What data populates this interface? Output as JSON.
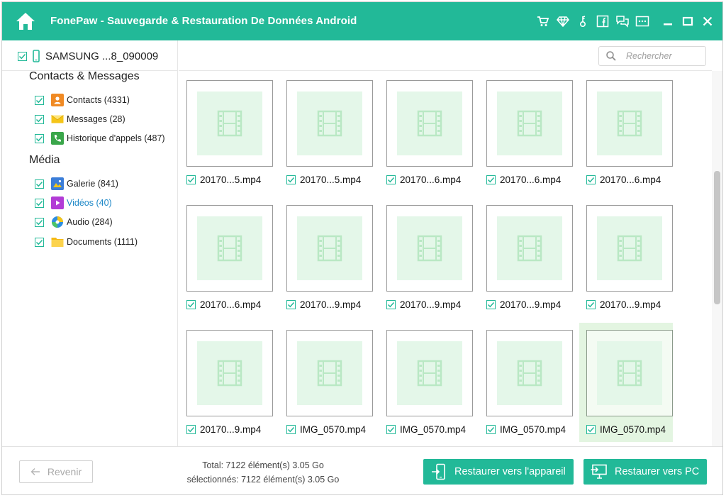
{
  "app": {
    "title": "FonePaw - Sauvegarde & Restauration De Données Android",
    "accent_color": "#22b998"
  },
  "titlebar": {
    "icons": [
      "home-icon",
      "cart-icon",
      "diamond-icon",
      "key-icon",
      "facebook-icon",
      "feedback-icon",
      "menu-icon",
      "minimize-icon",
      "maximize-icon",
      "close-icon"
    ]
  },
  "sidebar": {
    "device_name": "SAMSUNG ...8_090009",
    "sections": [
      {
        "title": "Contacts & Messages",
        "items": [
          {
            "label": "Contacts (4331)",
            "icon": "contacts-icon",
            "checked": true
          },
          {
            "label": "Messages (28)",
            "icon": "messages-icon",
            "checked": true
          },
          {
            "label": "Historique d'appels (487)",
            "icon": "call-history-icon",
            "checked": true
          }
        ]
      },
      {
        "title": "Média",
        "items": [
          {
            "label": "Galerie (841)",
            "icon": "gallery-icon",
            "checked": true
          },
          {
            "label": "Vidéos (40)",
            "icon": "videos-icon",
            "checked": true,
            "active": true
          },
          {
            "label": "Audio (284)",
            "icon": "audio-icon",
            "checked": true
          },
          {
            "label": "Documents (1111)",
            "icon": "documents-icon",
            "checked": true
          }
        ]
      }
    ]
  },
  "search": {
    "placeholder": "Rechercher",
    "value": ""
  },
  "files": [
    {
      "name": "20170...5.mp4",
      "checked": true
    },
    {
      "name": "20170...5.mp4",
      "checked": true
    },
    {
      "name": "20170...6.mp4",
      "checked": true
    },
    {
      "name": "20170...6.mp4",
      "checked": true
    },
    {
      "name": "20170...6.mp4",
      "checked": true
    },
    {
      "name": "20170...6.mp4",
      "checked": true
    },
    {
      "name": "20170...9.mp4",
      "checked": true
    },
    {
      "name": "20170...9.mp4",
      "checked": true
    },
    {
      "name": "20170...9.mp4",
      "checked": true
    },
    {
      "name": "20170...9.mp4",
      "checked": true
    },
    {
      "name": "20170...9.mp4",
      "checked": true
    },
    {
      "name": "IMG_0570.mp4",
      "checked": true
    },
    {
      "name": "IMG_0570.mp4",
      "checked": true
    },
    {
      "name": "IMG_0570.mp4",
      "checked": true
    },
    {
      "name": "IMG_0570.mp4",
      "checked": true,
      "selected": true
    }
  ],
  "footer": {
    "back_label": "Revenir",
    "total": "Total: 7122 élément(s) 3.05 Go",
    "selected": "sélectionnés: 7122 élément(s) 3.05 Go",
    "restore_device_label": "Restaurer vers l'appareil",
    "restore_pc_label": "Restaurer vers PC"
  }
}
